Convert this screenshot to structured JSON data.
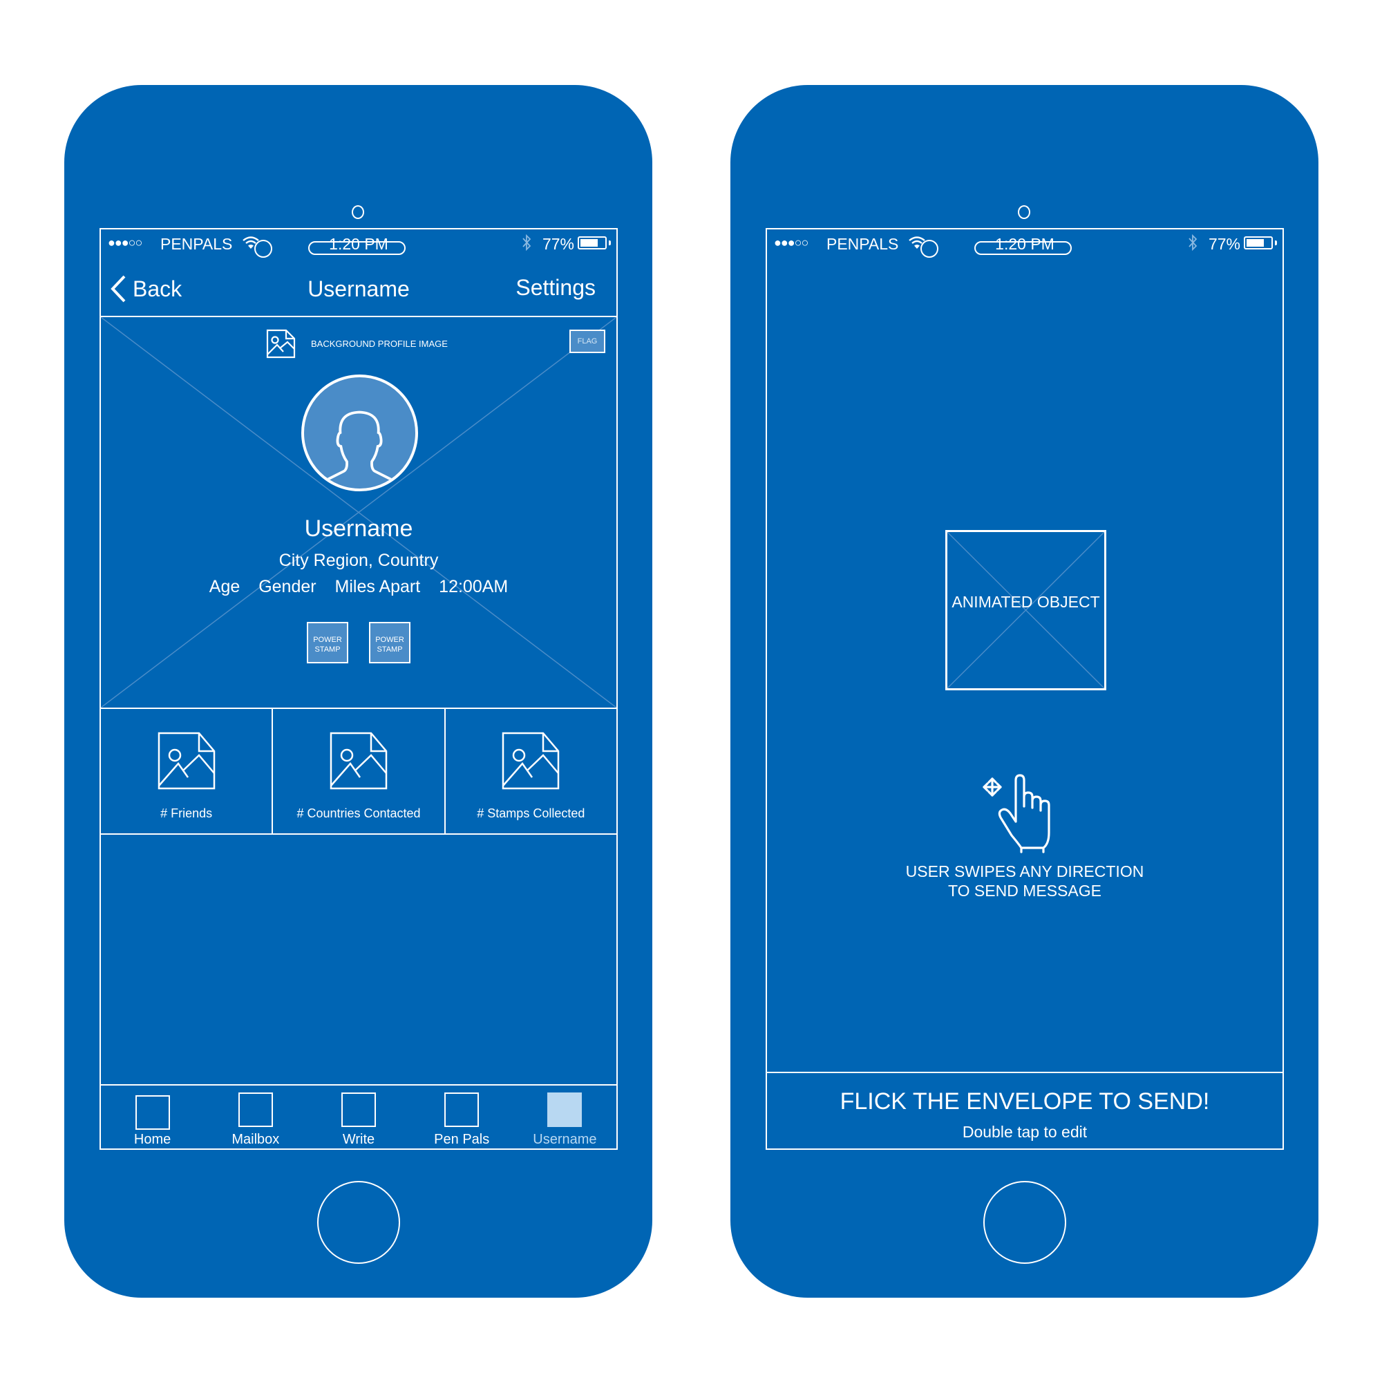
{
  "colors": {
    "phone_body": "#0065b4",
    "line": "#ffffff",
    "accent_light": "#4a8cc8",
    "active_tab": "#b8d8f2"
  },
  "phones": [
    {
      "status_bar": {
        "signal": "●●●○○",
        "carrier": "PENPALS",
        "wifi_icon": "wifi-icon",
        "time": "1:20 PM",
        "bluetooth_icon": "bluetooth-icon",
        "battery_percent": "77%",
        "battery_level": 0.77
      },
      "nav": {
        "back_label": "Back",
        "title": "Username",
        "settings_label": "Settings"
      },
      "profile": {
        "background_label": "BACKGROUND PROFILE IMAGE",
        "flag_label": "FLAG",
        "name": "Username",
        "location": "City Region, Country",
        "meta": [
          "Age",
          "Gender",
          "Miles Apart",
          "12:00AM"
        ],
        "stamps": [
          "POWER STAMP",
          "POWER STAMP"
        ]
      },
      "stats": [
        {
          "label": "# Friends",
          "icon": "image-file-icon"
        },
        {
          "label": "# Countries Contacted",
          "icon": "image-file-icon"
        },
        {
          "label": "# Stamps Collected",
          "icon": "image-file-icon"
        }
      ],
      "tabs": [
        {
          "label": "Home",
          "active": false
        },
        {
          "label": "Mailbox",
          "active": false
        },
        {
          "label": "Write",
          "active": false
        },
        {
          "label": "Pen Pals",
          "active": false
        },
        {
          "label": "Username",
          "active": true
        }
      ]
    },
    {
      "status_bar": {
        "signal": "●●●○○",
        "carrier": "PENPALS",
        "wifi_icon": "wifi-icon",
        "time": "1:20 PM",
        "bluetooth_icon": "bluetooth-icon",
        "battery_percent": "77%",
        "battery_level": 0.77
      },
      "animated_object_label": "ANIMATED OBJECT",
      "swipe_icon": "swipe-hand-icon",
      "swipe_text_line1": "USER SWIPES ANY DIRECTION",
      "swipe_text_line2": "TO SEND MESSAGE",
      "footer": {
        "title": "FLICK THE ENVELOPE TO SEND!",
        "subtitle": "Double tap to edit"
      }
    }
  ]
}
